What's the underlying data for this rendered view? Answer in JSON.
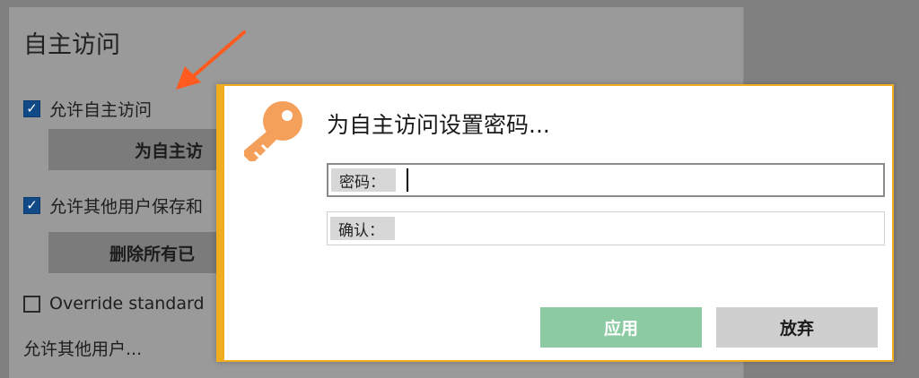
{
  "background": {
    "title": "自主访问",
    "allow_autonomous": {
      "label": "允许自主访问",
      "checked": true
    },
    "set_password_button": "为自主访",
    "allow_save": {
      "label": "允许其他用户保存和",
      "checked": true
    },
    "delete_button": "删除所有已",
    "override": {
      "label": "Override standard",
      "checked": false
    },
    "footer_text": "允许其他用户..."
  },
  "dialog": {
    "title": "为自主访问设置密码...",
    "password": {
      "label": "密码：",
      "value": ""
    },
    "confirm": {
      "label": "确认：",
      "value": ""
    },
    "apply_label": "应用",
    "discard_label": "放弃"
  },
  "colors": {
    "accent_border": "#f0ad1f",
    "key_icon": "#f5a05a",
    "apply_button": "#8bcaa3",
    "arrow": "#ff5a1f",
    "checkbox": "#114a86"
  },
  "icons": {
    "dialog_icon": "key-icon",
    "annotation": "arrow-pointer-icon"
  }
}
